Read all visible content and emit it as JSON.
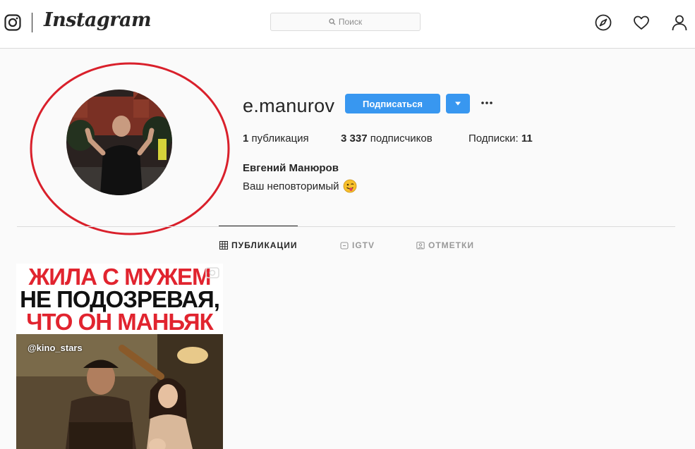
{
  "nav": {
    "brand": "Instagram",
    "search_placeholder": "Поиск",
    "icons": [
      "instagram-glyph-icon",
      "compass-icon",
      "heart-icon",
      "user-icon"
    ]
  },
  "profile": {
    "username": "e.manurov",
    "follow_label": "Подписаться",
    "stats": {
      "posts_count": "1",
      "posts_label": "публикация",
      "followers_count": "3 337",
      "followers_label": "подписчиков",
      "following_label": "Подписки:",
      "following_count": "11"
    },
    "full_name": "Евгений Манюров",
    "bio": "Ваш неповторимый",
    "bio_emoji": "winking-tongue-emoji"
  },
  "tabs": [
    {
      "label": "ПУБЛИКАЦИИ",
      "icon": "grid-icon",
      "active": true
    },
    {
      "label": "IGTV",
      "icon": "igtv-icon",
      "active": false
    },
    {
      "label": "ОТМЕТКИ",
      "icon": "tag-icon",
      "active": false
    }
  ],
  "post": {
    "title_lines": [
      "ЖИЛА С МУЖЕМ",
      "НЕ ПОДОЗРЕВАЯ,",
      "ЧТО ОН МАНЬЯК"
    ],
    "watermark": "@kino_stars",
    "icon": "video-icon"
  },
  "colors": {
    "accent": "#3897f0",
    "annotation": "#d9202b",
    "title_red": "#e1242f"
  }
}
